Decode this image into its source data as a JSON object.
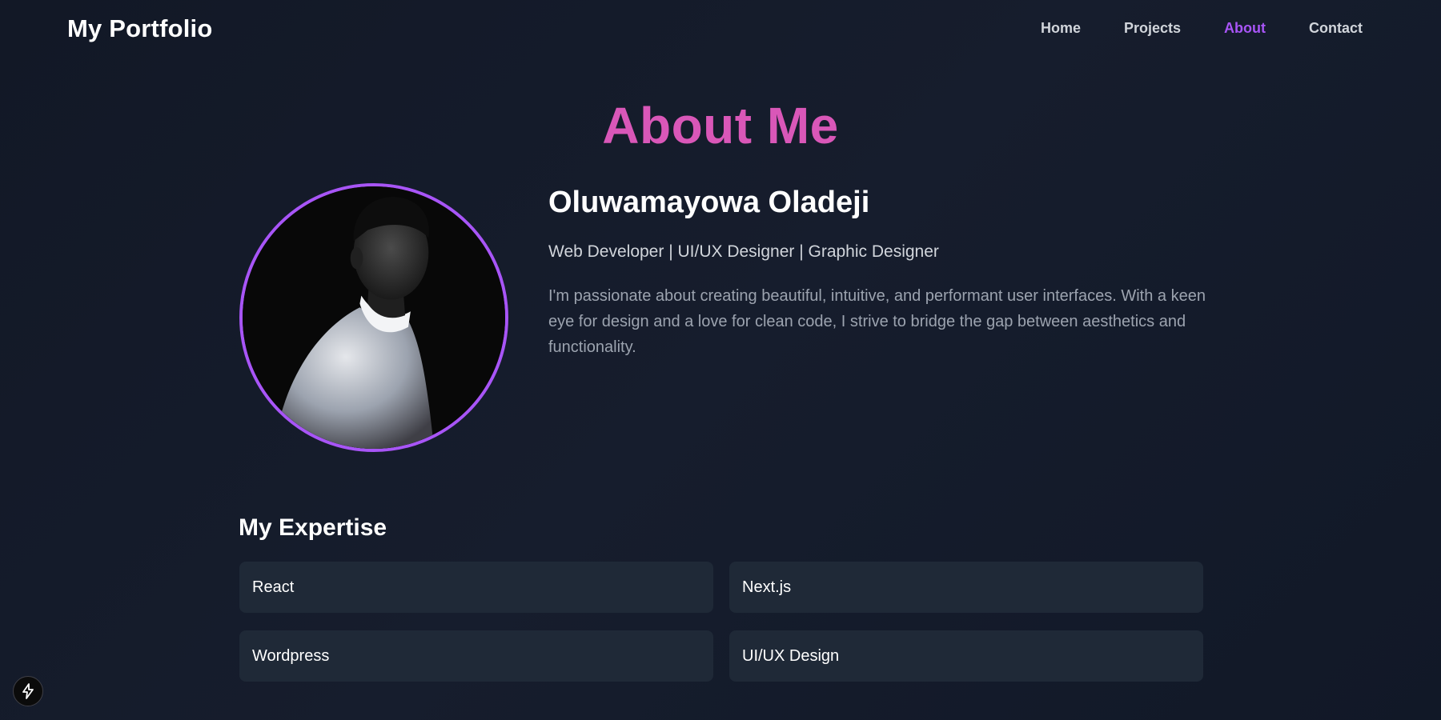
{
  "nav": {
    "brand": "My Portfolio",
    "links": [
      {
        "label": "Home",
        "active": false
      },
      {
        "label": "Projects",
        "active": false
      },
      {
        "label": "About",
        "active": true
      },
      {
        "label": "Contact",
        "active": false
      }
    ]
  },
  "about": {
    "title": "About Me",
    "name": "Oluwamayowa Oladeji",
    "role": "Web Developer | UI/UX Designer | Graphic Designer",
    "bio": "I'm passionate about creating beautiful, intuitive, and performant user interfaces. With a keen eye for design and a love for clean code, I strive to bridge the gap between aesthetics and functionality."
  },
  "expertise": {
    "title": "My Expertise",
    "skills": [
      {
        "label": "React"
      },
      {
        "label": "Next.js"
      },
      {
        "label": "Wordpress"
      },
      {
        "label": "UI/UX Design"
      }
    ]
  },
  "icons": {
    "avatar": "profile-photo",
    "badge": "lightning-bolt-icon"
  },
  "colors": {
    "accent": "#a855f7",
    "title_pink": "#d957b8",
    "background": "#121826",
    "card": "#1f2937"
  }
}
